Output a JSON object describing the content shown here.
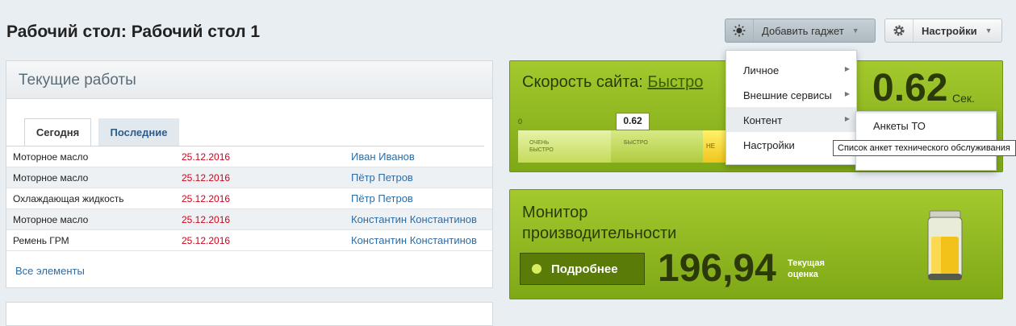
{
  "page": {
    "title": "Рабочий стол: Рабочий стол 1"
  },
  "toolbar": {
    "add_gadget_label": "Добавить гаджет",
    "settings_label": "Настройки"
  },
  "current_work": {
    "title": "Текущие работы",
    "tabs": [
      {
        "label": "Сегодня"
      },
      {
        "label": "Последние"
      }
    ],
    "rows": [
      {
        "item": "Моторное масло",
        "date": "25.12.2016",
        "person": "Иван Иванов"
      },
      {
        "item": "Моторное масло",
        "date": "25.12.2016",
        "person": "Пётр Петров"
      },
      {
        "item": "Охлаждающая жидкость",
        "date": "25.12.2016",
        "person": "Пётр Петров"
      },
      {
        "item": "Моторное масло",
        "date": "25.12.2016",
        "person": "Константин Константинов"
      },
      {
        "item": "Ремень ГРМ",
        "date": "25.12.2016",
        "person": "Константин Константинов"
      }
    ],
    "all_link": "Все элементы"
  },
  "site_speed": {
    "title": "Скорость сайта:",
    "status": "Быстро",
    "value": "0.62",
    "unit": "Сек.",
    "marker": "0.62",
    "zero": "0",
    "scale_labels": {
      "very_fast_1": "ОЧЕНЬ",
      "very_fast_2": "БЫСТРО",
      "fast": "БЫСТРО",
      "slow": "НЕ"
    }
  },
  "monitor": {
    "title_line1": "Монитор",
    "title_line2": "производительности",
    "more_button": "Подробнее",
    "value": "196,94",
    "label_line1": "Текущая",
    "label_line2": "оценка"
  },
  "gadget_menu": {
    "items": [
      {
        "label": "Личное"
      },
      {
        "label": "Внешние сервисы"
      },
      {
        "label": "Контент"
      },
      {
        "label": "Настройки"
      }
    ],
    "submenu_item": "Анкеты ТО",
    "tooltip": "Список анкет технического обслуживания"
  },
  "colors": {
    "accent_green": "#8db41f",
    "link_blue": "#2e6ca4",
    "date_red": "#d0021b"
  }
}
